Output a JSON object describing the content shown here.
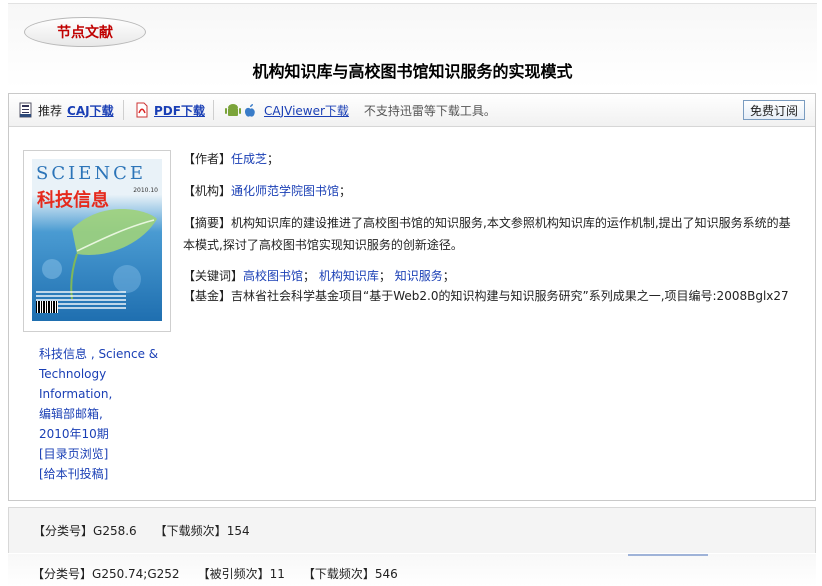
{
  "header": {
    "node_badge": "节点文献",
    "title": "机构知识库与高校图书馆知识服务的实现模式"
  },
  "toolbar": {
    "recommend_label": "推荐",
    "caj_download": "CAJ下载",
    "pdf_download": "PDF下载",
    "cajviewer_download": "CAJViewer下载",
    "note": "不支持迅雷等下载工具。",
    "free_read": "免费订阅"
  },
  "journal": {
    "cover_title_en": "SCIENCE",
    "cover_title_cn": "科技信息",
    "cover_issue": "2010.10",
    "lines": [
      "科技信息 , Science &",
      "Technology",
      "Information,",
      "编辑部邮箱,",
      "2010年10期",
      "[目录页浏览]",
      "[给本刊投稿]"
    ]
  },
  "meta": {
    "author_label": "【作者】",
    "author": "任成芝",
    "author_sep": "；",
    "org_label": "【机构】",
    "org": "通化师范学院图书馆",
    "org_sep": "；",
    "abstract_label": "【摘要】",
    "abstract": "机构知识库的建设推进了高校图书馆的知识服务,本文参照机构知识库的运作机制,提出了知识服务系统的基本模式,探讨了高校图书馆实现知识服务的创新途径。",
    "keywords_label": "【关键词】",
    "keywords": [
      "高校图书馆",
      "机构知识库",
      "知识服务"
    ],
    "keyword_sep": "；",
    "fund_label": "【基金】",
    "fund": "吉林省社会科学基金项目“基于Web2.0的知识构建与知识服务研究”系列成果之一,项目编号:2008Bglx27"
  },
  "block2": {
    "class_label": "【分类号】",
    "class_value": "G258.6",
    "download_label": "【下载频次】",
    "download_value": "154"
  },
  "block3": {
    "class_label": "【分类号】",
    "class_value": "G250.74;G252",
    "cited_label": "【被引频次】",
    "cited_value": "11",
    "download_label": "【下载频次】",
    "download_value": "546"
  }
}
